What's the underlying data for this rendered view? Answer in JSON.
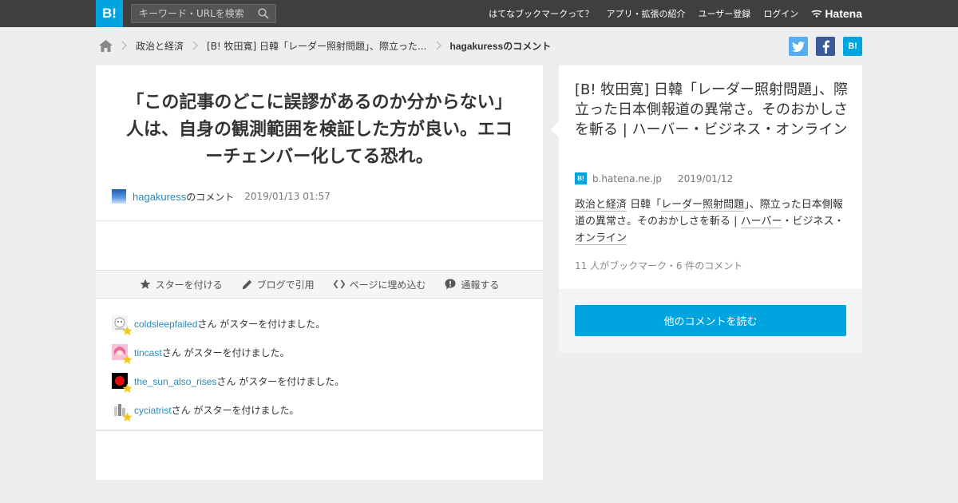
{
  "header": {
    "logo": "B!",
    "search_placeholder": "キーワード・URLを検索",
    "nav": [
      "はてなブックマークって？",
      "アプリ・拡張の紹介",
      "ユーザー登録",
      "ログイン"
    ],
    "brand": "Hatena"
  },
  "breadcrumb": {
    "category": "政治と経済",
    "entry": "[B! 牧田寛] 日韓「レーダー照射問題」、際立った...",
    "current": "hagakuressのコメント"
  },
  "comment": {
    "text": "「この記事のどこに誤謬があるのか分からない」人は、自身の観測範囲を検証した方が良い。エコーチェンバー化してる恐れ。",
    "user": "hagakuress",
    "suffix": "のコメント",
    "timestamp": "2019/01/13 01:57"
  },
  "actions": [
    {
      "label": "スターを付ける",
      "icon": "star-icon"
    },
    {
      "label": "ブログで引用",
      "icon": "pencil-icon"
    },
    {
      "label": "ページに埋め込む",
      "icon": "code-icon"
    },
    {
      "label": "通報する",
      "icon": "report-icon"
    }
  ],
  "stars": [
    {
      "user": "coldsleepfailed",
      "text": "さん がスターを付けました。"
    },
    {
      "user": "tincast",
      "text": "さん がスターを付けました。"
    },
    {
      "user": "the_sun_also_rises",
      "text": "さん がスターを付けました。"
    },
    {
      "user": "cyciatrist",
      "text": "さん がスターを付けました。"
    }
  ],
  "article": {
    "title": "[B! 牧田寛] 日韓「レーダー照射問題」、際立った日本側報道の異常さ。そのおかしさを斬る | ハーバー・ビジネス・オンライン",
    "domain": "b.hatena.ne.jp",
    "date": "2019/01/12",
    "tag_category": "政治と経済",
    "tags_a": "日韓「",
    "tags_kw1": "レーダー照射問題",
    "tags_b": "」、際立った日本側報道の異常さ。そのおかしさを斬る | ",
    "tags_kw2": "ハーバー",
    "tags_c": "・ビジネス・",
    "tags_kw3": "オンライン",
    "counts": "11 人がブックマーク・6 件のコメント"
  },
  "read_more": "他のコメントを読む",
  "colors": {
    "brand": "#00a4de",
    "topbar": "#3f3f3f",
    "link": "#2a8ab8",
    "star": "#f5c518"
  }
}
